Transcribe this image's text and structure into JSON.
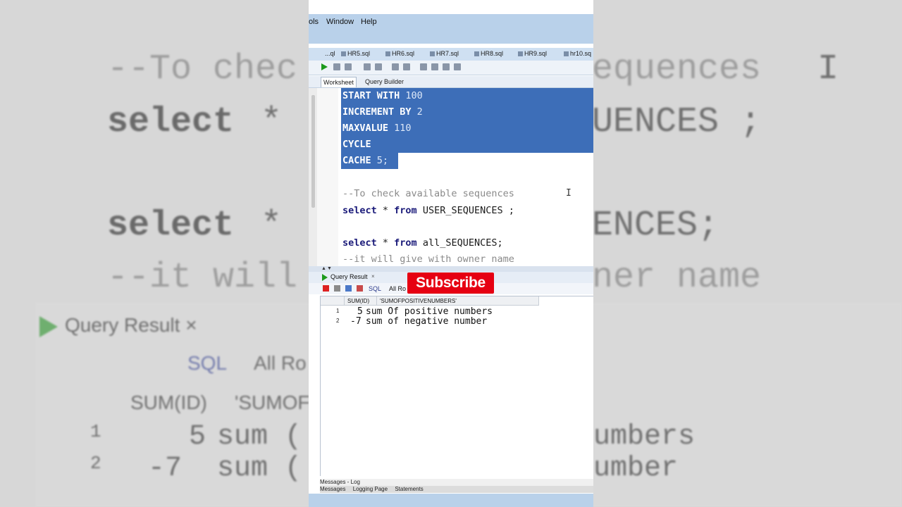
{
  "menu": {
    "tools_partial": "ols",
    "window": "Window",
    "help": "Help"
  },
  "file_tabs": [
    "...ql",
    "HR5.sql",
    "HR6.sql",
    "HR7.sql",
    "HR8.sql",
    "HR9.sql",
    "hr10.sq"
  ],
  "sub_tabs": {
    "worksheet": "Worksheet",
    "query_builder": "Query Builder"
  },
  "code_lines": {
    "l1_kw": "START WITH",
    "l1_val": " 100",
    "l2_kw": "INCREMENT BY",
    "l2_val": " 2",
    "l3_kw": "MAXVALUE",
    "l3_val": " 110",
    "l4_kw": "CYCLE",
    "l5_kw": "CACHE",
    "l5_val": " 5;",
    "c1": "--To check available sequences",
    "s1_kw": "select",
    "s1_star": " * ",
    "s1_from": "from",
    "s1_rest": " USER_SEQUENCES ;",
    "s2_kw": "select",
    "s2_star": " * ",
    "s2_from": "from",
    "s2_rest": " all_SEQUENCES;",
    "c2": "--it will give with owner name"
  },
  "result_panel": {
    "tab_label": "Query Result",
    "close": "×",
    "sql_label": "SQL",
    "all_rows": "All Ro",
    "columns": [
      "SUM(ID)",
      "'SUMOFPOSITIVENUMBERS'"
    ],
    "rows": [
      {
        "n": "1",
        "sum": "5",
        "text": "sum Of positive numbers"
      },
      {
        "n": "2",
        "sum": "-7",
        "text": "sum of negative number"
      }
    ]
  },
  "overlay": {
    "subscribe": "Subscribe"
  },
  "bottom": {
    "messages_log": "Messages - Log",
    "tabs": [
      "Messages",
      "Logging Page",
      "Statements"
    ]
  },
  "background": {
    "comment": "--To chec",
    "comment_right": "equences",
    "cursor": "I",
    "select1_left": "select",
    "star": "*",
    "select1_right": "UENCES ;",
    "select2_left": "select",
    "select2_right": "ENCES;",
    "comment2_left": "--it will",
    "comment2_right": "ner name",
    "tab": "Query Result",
    "tab_close": "×",
    "sql": "SQL",
    "allrows": "All Ro",
    "col1": "SUM(ID)",
    "col2": "'SUMOFI",
    "r1_n": "1",
    "r1_v": "5",
    "r1_t": "sum (",
    "r1_right": "umbers",
    "r2_n": "2",
    "r2_v": "-7",
    "r2_t": "sum (",
    "r2_right": "umber"
  },
  "colors": {
    "selection": "#3d6eb8",
    "subscribe": "#e60012",
    "menubar": "#b9d1ea",
    "run": "#1c9a1c"
  }
}
